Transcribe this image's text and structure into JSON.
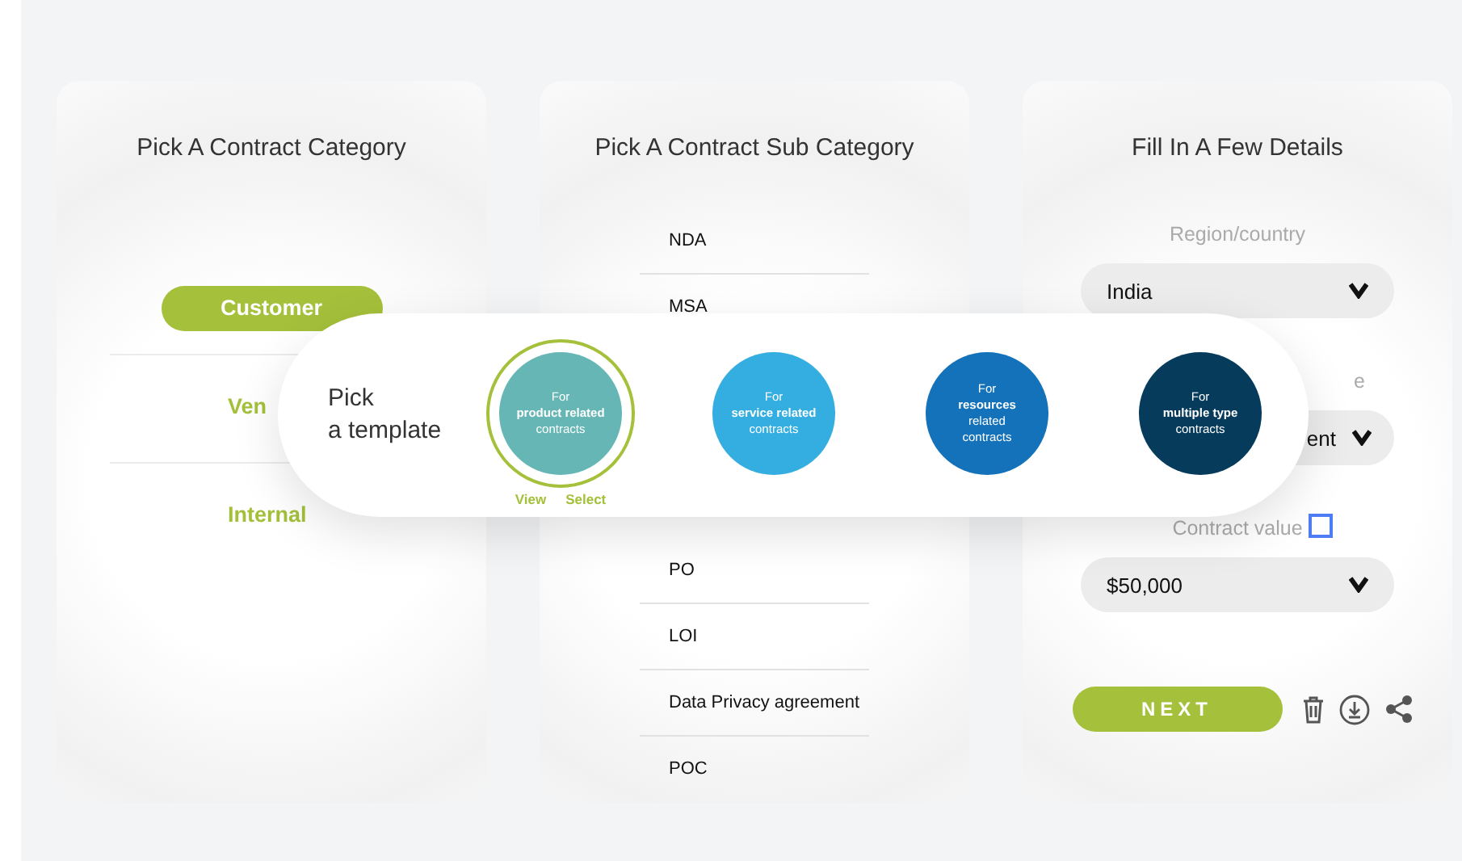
{
  "category_card": {
    "title": "Pick A Contract Category",
    "categories": [
      {
        "label": "Customer",
        "selected": true
      },
      {
        "label": "Ven",
        "selected": false
      },
      {
        "label": "Internal",
        "selected": false
      }
    ]
  },
  "subcategory_card": {
    "title": "Pick A Contract Sub Category",
    "groups": [
      [
        "NDA",
        "MSA"
      ],
      [
        "PO",
        "LOI",
        "Data Privacy agreement",
        "POC"
      ]
    ]
  },
  "details_card": {
    "title": "Fill In A Few Details",
    "fields": [
      {
        "kind": "full",
        "label": "Region/country",
        "value": "India"
      },
      {
        "kind": "partial",
        "label": "e",
        "value": "ent"
      },
      {
        "kind": "full",
        "label": "Contract value",
        "value": "$50,000"
      }
    ],
    "next_button": "NEXT"
  },
  "template_picker": {
    "title_lines": [
      "Pick",
      "a template"
    ],
    "templates": [
      {
        "lines": [
          "For",
          "product related",
          "contracts"
        ],
        "color": "#65b6b4",
        "selected": true
      },
      {
        "lines": [
          "For",
          "service related",
          "contracts"
        ],
        "color": "#34aee0",
        "selected": false
      },
      {
        "lines": [
          "For",
          "resources",
          "related",
          "contracts"
        ],
        "color": "#1472ba",
        "selected": false
      },
      {
        "lines": [
          "For",
          "multiple type",
          "contracts"
        ],
        "color": "#073b5c",
        "selected": false
      }
    ],
    "actions": [
      "View",
      "Select"
    ]
  }
}
